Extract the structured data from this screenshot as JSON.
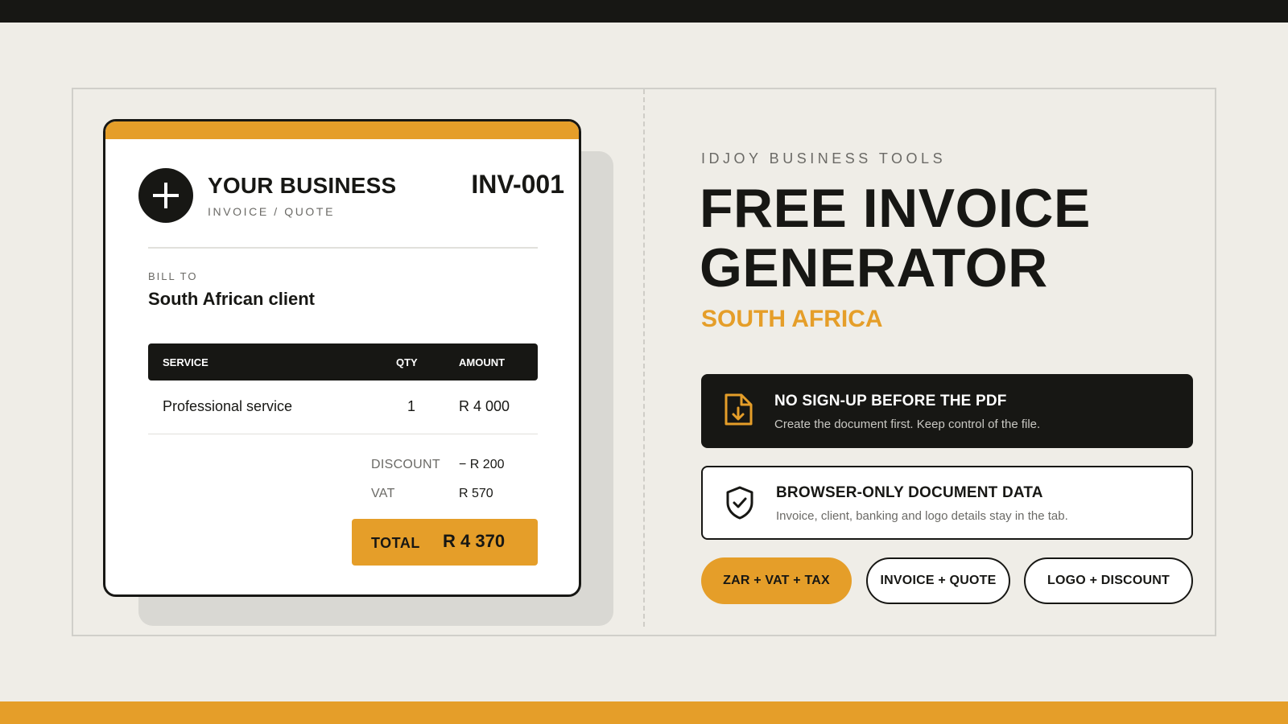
{
  "invoice": {
    "business_name": "YOUR BUSINESS",
    "business_sub": "INVOICE / QUOTE",
    "number": "INV-001",
    "bill_to_label": "BILL TO",
    "client_name": "South African client",
    "table": {
      "headers": {
        "service": "SERVICE",
        "qty": "QTY",
        "amount": "AMOUNT"
      },
      "rows": [
        {
          "service": "Professional service",
          "qty": "1",
          "amount": "R 4 000"
        }
      ]
    },
    "discount_label": "DISCOUNT",
    "discount_value": "− R 200",
    "vat_label": "VAT",
    "vat_value": "R 570",
    "total_label": "TOTAL",
    "total_value": "R 4 370"
  },
  "hero": {
    "eyebrow": "IDJOY BUSINESS TOOLS",
    "headline_line1": "FREE INVOICE",
    "headline_line2": "GENERATOR",
    "subhead": "SOUTH AFRICA"
  },
  "features": [
    {
      "icon": "document-download-icon",
      "title": "NO SIGN-UP BEFORE THE PDF",
      "desc": "Create the document first. Keep control of the file."
    },
    {
      "icon": "shield-check-icon",
      "title": "BROWSER-ONLY DOCUMENT DATA",
      "desc": "Invoice, client, banking and logo details stay in the tab."
    }
  ],
  "pills": [
    {
      "label": "ZAR + VAT + TAX"
    },
    {
      "label": "INVOICE + QUOTE"
    },
    {
      "label": "LOGO + DISCOUNT"
    }
  ],
  "colors": {
    "accent": "#e59e29",
    "dark": "#171714",
    "background": "#efede7",
    "muted": "#6b6a66"
  }
}
